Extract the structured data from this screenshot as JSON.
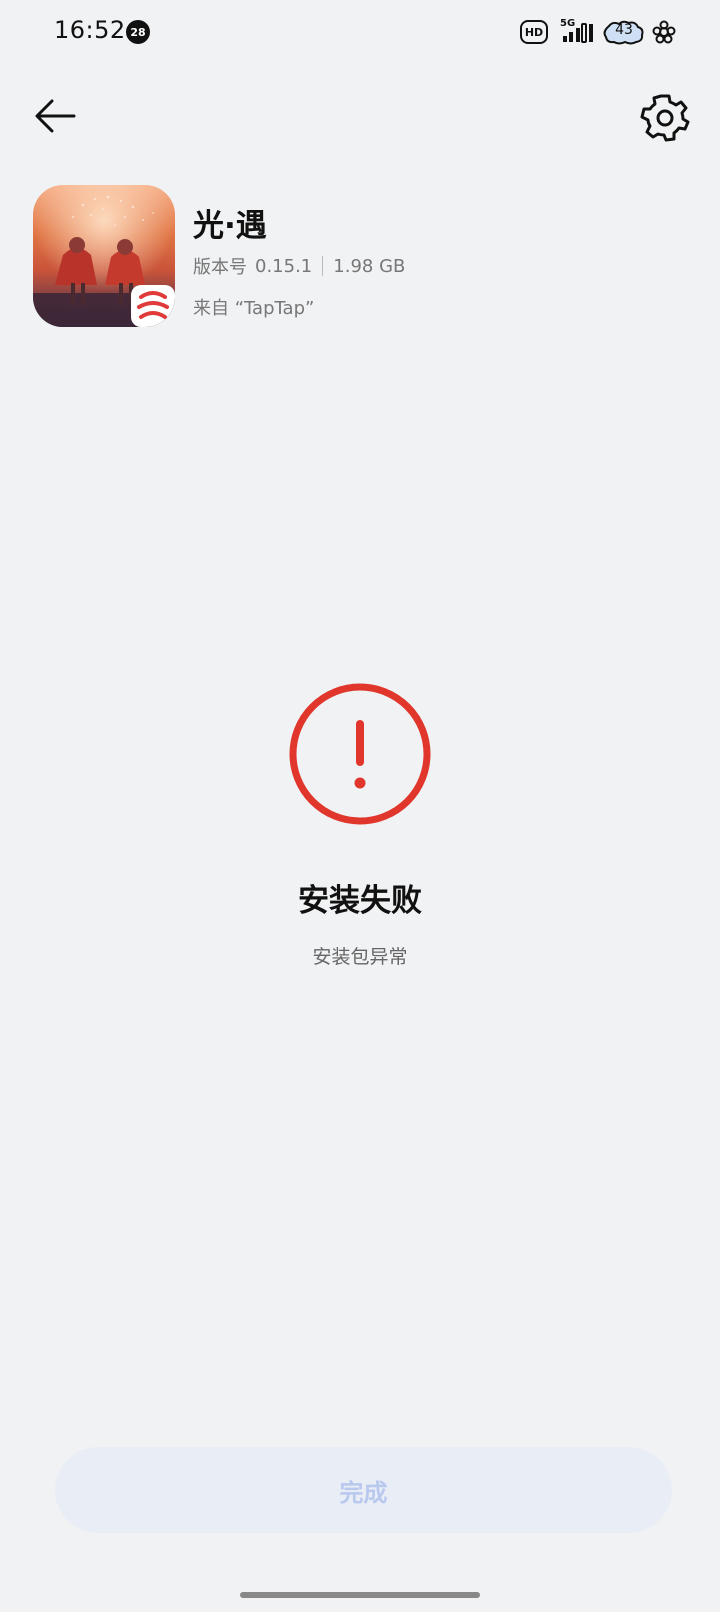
{
  "status_bar": {
    "time": "16:52",
    "notification_count": "28",
    "hd_label": "HD",
    "network": "5G",
    "battery_level": "43"
  },
  "nav": {
    "back_icon": "arrow-left-icon",
    "settings_icon": "gear-icon"
  },
  "app": {
    "name": "光·遇",
    "version_label": "版本号",
    "version": "0.15.1",
    "size": "1.98 GB",
    "source": "来自 “TapTap”"
  },
  "result": {
    "status_icon": "warning-circle-icon",
    "title": "安装失败",
    "subtitle": "安装包异常",
    "accent_color": "#e0362c"
  },
  "actions": {
    "done_label": "完成"
  }
}
